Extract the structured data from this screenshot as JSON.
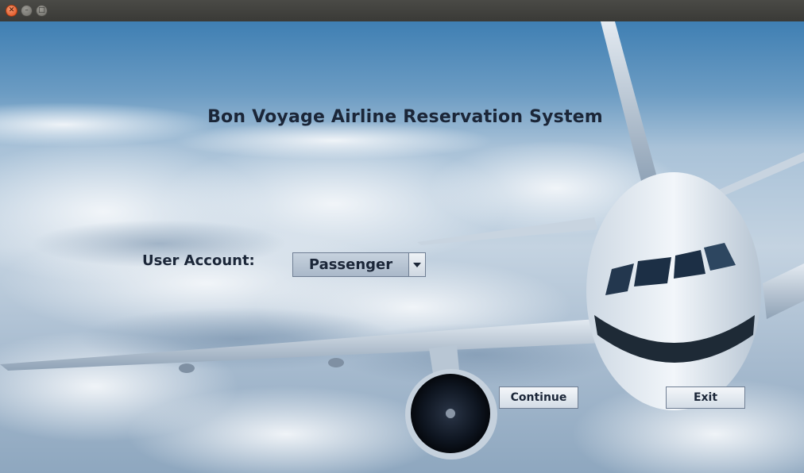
{
  "window": {
    "controls": {
      "close_icon": "close-icon",
      "minimize_icon": "minimize-icon",
      "maximize_icon": "maximize-icon"
    }
  },
  "main": {
    "title": "Bon Voyage Airline Reservation System",
    "user_account_label": "User Account:",
    "user_account_selected": "Passenger",
    "continue_label": "Continue",
    "exit_label": "Exit"
  },
  "colors": {
    "text": "#1b2638",
    "titlebar": "#3c3c3a",
    "close_button": "#e8541e",
    "sky_top": "#3f7fb3"
  }
}
